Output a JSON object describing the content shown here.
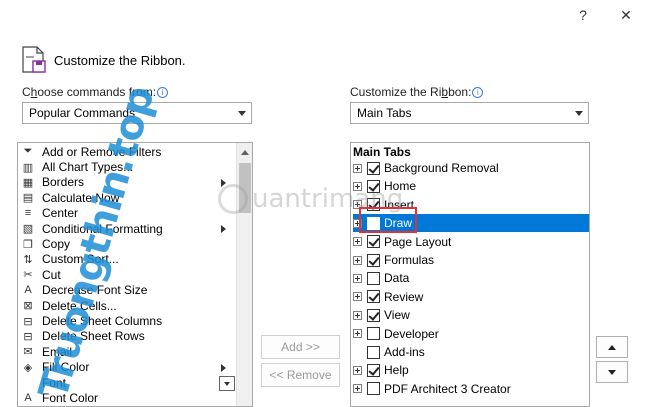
{
  "window": {
    "help_label": "?",
    "close_label": "✕"
  },
  "header": {
    "title": "Customize the Ribbon."
  },
  "left": {
    "label_prefix": "C",
    "label_underlined": "h",
    "label_rest": "oose commands from:",
    "dropdown_value": "Popular Commands",
    "commands": [
      {
        "label": "Add or Remove Filters",
        "icon": "filter-icon",
        "glyph": "⏷",
        "submenu": false
      },
      {
        "label": "All Chart Types...",
        "icon": "chart-icon",
        "glyph": "▥",
        "submenu": false
      },
      {
        "label": "Borders",
        "icon": "borders-icon",
        "glyph": "▦",
        "submenu": true
      },
      {
        "label": "Calculate Now",
        "icon": "calculator-icon",
        "glyph": "▤",
        "submenu": false
      },
      {
        "label": "Center",
        "icon": "align-center-icon",
        "glyph": "≡",
        "submenu": false
      },
      {
        "label": "Conditional Formatting",
        "icon": "conditional-formatting-icon",
        "glyph": "▧",
        "submenu": true
      },
      {
        "label": "Copy",
        "icon": "copy-icon",
        "glyph": "❐",
        "submenu": false
      },
      {
        "label": "Custom Sort...",
        "icon": "sort-icon",
        "glyph": "⇅",
        "submenu": false
      },
      {
        "label": "Cut",
        "icon": "cut-icon",
        "glyph": "✂",
        "submenu": false
      },
      {
        "label": "Decrease Font Size",
        "icon": "decrease-font-icon",
        "glyph": "A",
        "submenu": false
      },
      {
        "label": "Delete Cells...",
        "icon": "delete-cells-icon",
        "glyph": "⊠",
        "submenu": false
      },
      {
        "label": "Delete Sheet Columns",
        "icon": "delete-columns-icon",
        "glyph": "⊟",
        "submenu": false
      },
      {
        "label": "Delete Sheet Rows",
        "icon": "delete-rows-icon",
        "glyph": "⊟",
        "submenu": false
      },
      {
        "label": "Email",
        "icon": "email-icon",
        "glyph": "✉",
        "submenu": false
      },
      {
        "label": "Fill Color",
        "icon": "fill-color-icon",
        "glyph": "◈",
        "submenu": true
      },
      {
        "label": "Font",
        "icon": "font-icon",
        "glyph": "",
        "submenu": false
      },
      {
        "label": "Font Color",
        "icon": "font-color-icon",
        "glyph": "A",
        "submenu": false
      }
    ]
  },
  "right": {
    "label_prefix": "Customize the Ri",
    "label_underlined": "b",
    "label_rest": "bon:",
    "dropdown_value": "Main Tabs",
    "tree_header": "Main Tabs",
    "tabs": [
      {
        "label": "Background Removal",
        "checked": true,
        "expander": true,
        "selected": false
      },
      {
        "label": "Home",
        "checked": true,
        "expander": true,
        "selected": false
      },
      {
        "label": "Insert",
        "checked": true,
        "expander": true,
        "selected": false
      },
      {
        "label": "Draw",
        "checked": false,
        "expander": true,
        "selected": true
      },
      {
        "label": "Page Layout",
        "checked": true,
        "expander": true,
        "selected": false
      },
      {
        "label": "Formulas",
        "checked": true,
        "expander": true,
        "selected": false
      },
      {
        "label": "Data",
        "checked": false,
        "expander": true,
        "selected": false
      },
      {
        "label": "Review",
        "checked": true,
        "expander": true,
        "selected": false
      },
      {
        "label": "View",
        "checked": true,
        "expander": true,
        "selected": false
      },
      {
        "label": "Developer",
        "checked": false,
        "expander": true,
        "selected": false
      },
      {
        "label": "Add-ins",
        "checked": false,
        "expander": false,
        "selected": false
      },
      {
        "label": "Help",
        "checked": true,
        "expander": true,
        "selected": false
      },
      {
        "label": "PDF Architect 3 Creator",
        "checked": false,
        "expander": true,
        "selected": false
      }
    ]
  },
  "buttons": {
    "add_label": "Add >>",
    "remove_label": "<< Remove"
  },
  "watermark": {
    "vertical_text": "Truongthin.top",
    "center_text": "uantrimang"
  },
  "colors": {
    "selection": "#0078d7",
    "highlight": "#e0303a",
    "info": "#3a7bd5"
  }
}
